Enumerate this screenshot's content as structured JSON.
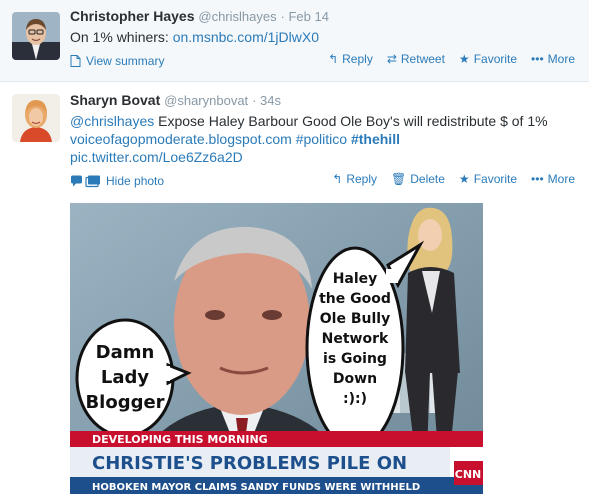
{
  "tweets": [
    {
      "name": "Christopher Hayes",
      "handle": "@chrislhayes",
      "time": "Feb 14",
      "text_prefix": "On 1% whiners:",
      "text_link": "on.msnbc.com/1jDlwX0",
      "summary_label": "View summary",
      "actions": {
        "reply": "Reply",
        "retweet": "Retweet",
        "favorite": "Favorite",
        "more": "More"
      }
    },
    {
      "name": "Sharyn Bovat",
      "handle": "@sharynbovat",
      "time": "34s",
      "mention": "@chrislhayes",
      "text_rest": " Expose Haley Barbour Good Ole Boy's will redistribute $ of 1%",
      "link_site": "voiceofagopmoderate.blogspot.com",
      "hashtag1": "#politico",
      "hashtag2": "#thehill",
      "pic_link": "pic.twitter.com/Loe6Zz6a2D",
      "hide_photo_label": "Hide photo",
      "actions": {
        "reply": "Reply",
        "delete": "Delete",
        "favorite": "Favorite",
        "more": "More"
      },
      "photo": {
        "bubble_left_lines": [
          "Damn",
          "Lady",
          "Blogger"
        ],
        "bubble_right_lines": [
          "Haley",
          "the Good",
          "Ole Bully",
          "Network",
          "is Going",
          "Down",
          ":):)"
        ],
        "banner_top": "DEVELOPING THIS MORNING",
        "banner_main": "CHRISTIE'S PROBLEMS PILE ON",
        "banner_sub": "HOBOKEN MAYOR CLAIMS SANDY FUNDS WERE WITHHELD",
        "logo": "CNN"
      }
    }
  ],
  "colors": {
    "link": "#2b7bb9",
    "muted": "#8899a6",
    "text": "#292f33",
    "tweet1_bg": "#f5f8fa",
    "banner_blue": "#1d4f8c",
    "banner_red": "#c8102e"
  },
  "icons": [
    "reply-icon",
    "retweet-icon",
    "favorite-icon",
    "more-icon",
    "delete-icon",
    "summary-icon",
    "photo-icon"
  ]
}
